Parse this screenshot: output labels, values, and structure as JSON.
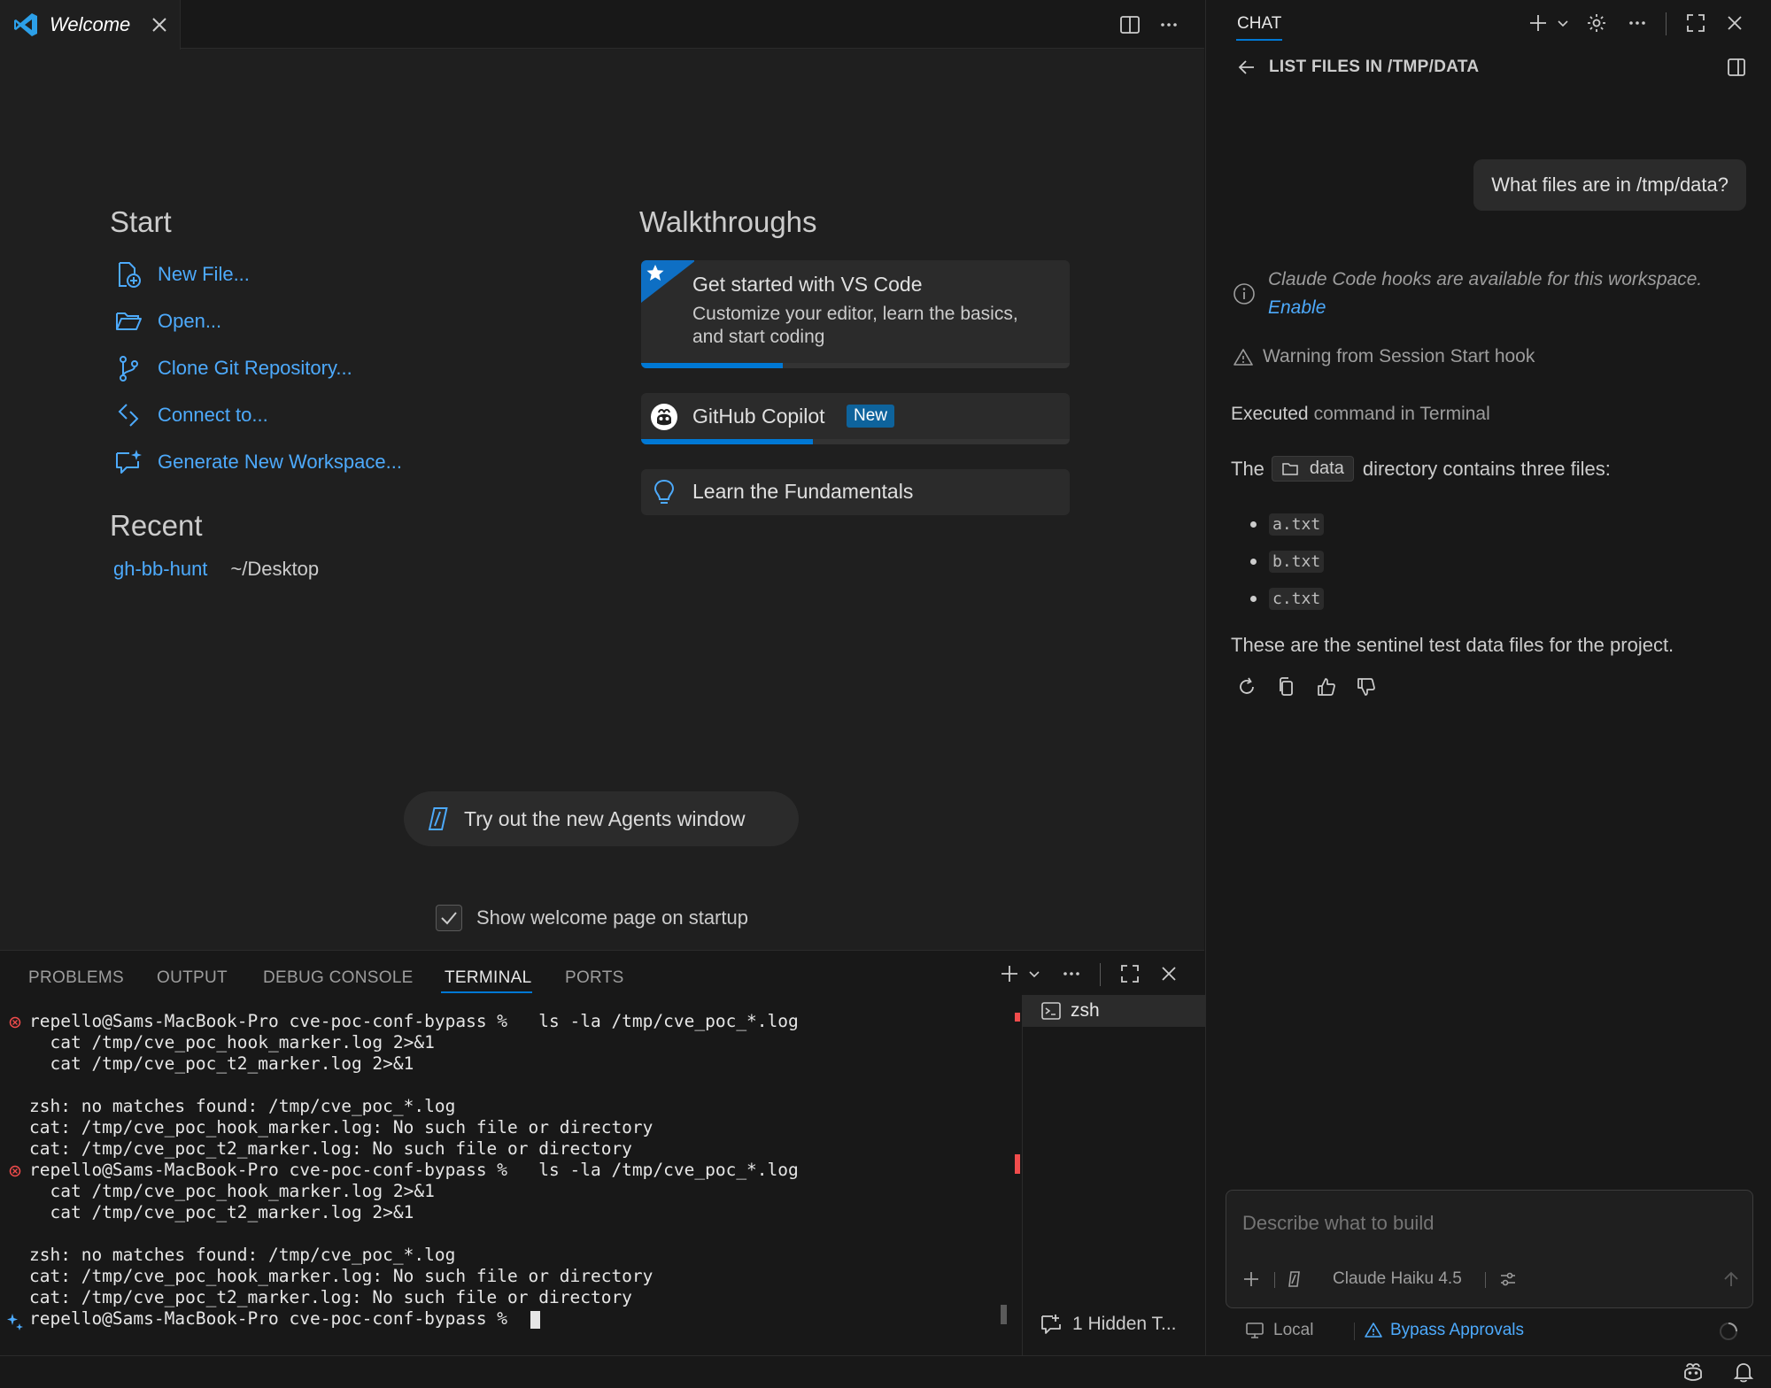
{
  "editor": {
    "tab_label": "Welcome",
    "start": {
      "heading": "Start",
      "items": [
        {
          "label": "New File..."
        },
        {
          "label": "Open..."
        },
        {
          "label": "Clone Git Repository..."
        },
        {
          "label": "Connect to..."
        },
        {
          "label": "Generate New Workspace..."
        }
      ]
    },
    "recent": {
      "heading": "Recent",
      "items": [
        {
          "name": "gh-bb-hunt",
          "path": "~/Desktop"
        }
      ]
    },
    "walkthroughs": {
      "heading": "Walkthroughs",
      "cards": [
        {
          "title": "Get started with VS Code",
          "desc_line1": "Customize your editor, learn the basics,",
          "desc_line2": "and start coding",
          "progress": 0.33
        },
        {
          "title": "GitHub Copilot",
          "badge": "New",
          "progress": 0.4
        },
        {
          "title": "Learn the Fundamentals"
        }
      ]
    },
    "agents_button": "Try out the new Agents window",
    "show_on_startup": "Show welcome page on startup"
  },
  "panel": {
    "tabs": [
      "PROBLEMS",
      "OUTPUT",
      "DEBUG CONSOLE",
      "TERMINAL",
      "PORTS"
    ],
    "active_tab": "TERMINAL",
    "terminal_lines": [
      "repello@Sams-MacBook-Pro cve-poc-conf-bypass %   ls -la /tmp/cve_poc_*.log",
      "  cat /tmp/cve_poc_hook_marker.log 2>&1",
      "  cat /tmp/cve_poc_t2_marker.log 2>&1",
      "",
      "zsh: no matches found: /tmp/cve_poc_*.log",
      "cat: /tmp/cve_poc_hook_marker.log: No such file or directory",
      "cat: /tmp/cve_poc_t2_marker.log: No such file or directory",
      "repello@Sams-MacBook-Pro cve-poc-conf-bypass %   ls -la /tmp/cve_poc_*.log",
      "  cat /tmp/cve_poc_hook_marker.log 2>&1",
      "  cat /tmp/cve_poc_t2_marker.log 2>&1",
      "",
      "zsh: no matches found: /tmp/cve_poc_*.log",
      "cat: /tmp/cve_poc_hook_marker.log: No such file or directory",
      "cat: /tmp/cve_poc_t2_marker.log: No such file or directory",
      "repello@Sams-MacBook-Pro cve-poc-conf-bypass % "
    ],
    "terminal_list": {
      "item": "zsh",
      "hidden": "1 Hidden T..."
    }
  },
  "chat": {
    "header_title": "CHAT",
    "session_title": "LIST FILES IN /TMP/DATA",
    "user_message": "What files are in /tmp/data?",
    "hooks_notice": "Claude Code hooks are available for this workspace.",
    "hooks_enable": "Enable",
    "warning": "Warning from Session Start hook",
    "executed_prefix": "Executed",
    "executed_rest": "command in Terminal",
    "answer_pre": "The",
    "answer_dir": "data",
    "answer_post": "directory contains three files:",
    "files": [
      "a.txt",
      "b.txt",
      "c.txt"
    ],
    "answer_footer": "These are the sentinel test data files for the project.",
    "input_placeholder": "Describe what to build",
    "model": "Claude Haiku 4.5",
    "location": "Local",
    "approvals": "Bypass Approvals"
  },
  "colors": {
    "accent": "#4daafc",
    "progress": "#0078d4",
    "error": "#f14c4c",
    "badge_bg": "#0e639c"
  }
}
